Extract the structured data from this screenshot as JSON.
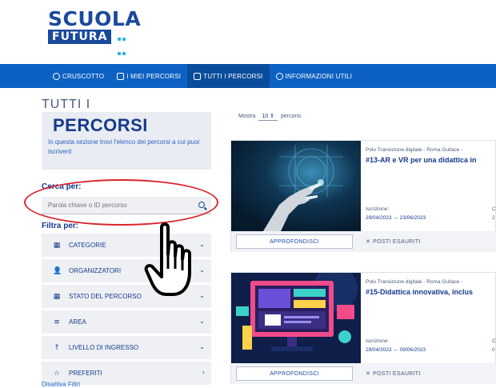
{
  "logo": {
    "line1": "SCUOLA",
    "line2": "FUTURA"
  },
  "nav": {
    "items": [
      {
        "label": "CRUSCOTTO",
        "icon": "dashboard-icon"
      },
      {
        "label": "I MIEI PERCORSI",
        "icon": "monitor-icon"
      },
      {
        "label": "TUTTI I PERCORSI",
        "icon": "grid-icon",
        "active": true
      },
      {
        "label": "INFORMAZIONI UTILI",
        "icon": "info-icon"
      }
    ]
  },
  "sidebar": {
    "title_small": "TUTTI I",
    "title_big": "PERCORSI",
    "description": "In questa sezione trovi l'elenco dei percorsi a cui puoi iscriverti",
    "search_label": "Cerca per:",
    "search_placeholder": "Parola chiave o ID percorso",
    "filter_label": "Filtra per:",
    "filters": [
      {
        "label": "CATEGORIE",
        "icon": "grid-icon"
      },
      {
        "label": "ORGANIZZATORI",
        "icon": "user-icon"
      },
      {
        "label": "STATO DEL PERCORSO",
        "icon": "grid-icon"
      },
      {
        "label": "AREA",
        "icon": "list-icon"
      },
      {
        "label": "LIVELLO DI INGRESSO",
        "icon": "arrow-up-icon"
      },
      {
        "label": "PREFERITI",
        "icon": "star-icon"
      }
    ],
    "disable_filters": "Disattiva Filtri"
  },
  "listing": {
    "show_label": "Mostra",
    "show_value": "10",
    "show_suffix": "percorsi"
  },
  "cards": [
    {
      "organizer": "Polo Transizione digitale - Roma Gullace -",
      "title": "#13-AR e VR per una didattica in",
      "enroll_label": "Iscrizione:",
      "dates": "29/04/2023 ↔ 23/06/2023",
      "extra": "C",
      "extra2": "2",
      "button": "APPROFONDISCI",
      "status": "POSTI ESAURITI"
    },
    {
      "organizer": "Polo Transizione digitale - Roma Gullace -",
      "title": "#15-Didattica innovativa, inclus",
      "enroll_label": "Iscrizione:",
      "dates": "29/04/2023 ↔ 09/06/2023",
      "extra": "C",
      "extra2": "0",
      "button": "APPROFONDISCI",
      "status": "POSTI ESAURITI"
    }
  ]
}
